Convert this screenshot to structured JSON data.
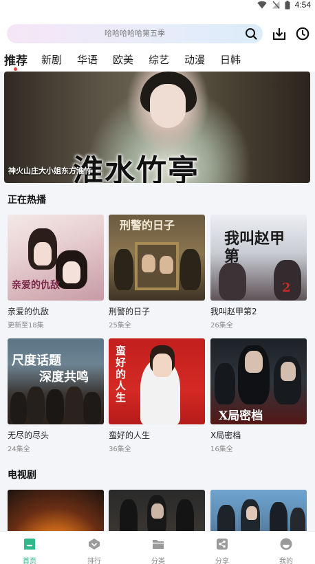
{
  "status_bar": {
    "time": "4:54"
  },
  "search": {
    "placeholder": "哈哈哈哈哈第五季"
  },
  "tabs": [
    {
      "label": "推荐",
      "active": true
    },
    {
      "label": "新剧"
    },
    {
      "label": "华语"
    },
    {
      "label": "欧美"
    },
    {
      "label": "综艺"
    },
    {
      "label": "动漫"
    },
    {
      "label": "日韩"
    }
  ],
  "banner": {
    "caption": "神火山庄大小姐东方淮竹",
    "artwork_text": "淮水竹亭"
  },
  "sections": [
    {
      "title": "正在热播",
      "items": [
        {
          "title": "亲爱的仇敌",
          "subtitle": "更新至18集",
          "poster_text": "亲爱的仇敌"
        },
        {
          "title": "刑警的日子",
          "subtitle": "25集全",
          "poster_text": "刑警的日子"
        },
        {
          "title": "我叫赵甲第2",
          "subtitle": "26集全",
          "poster_text": "我叫赵甲第"
        },
        {
          "title": "无尽的尽头",
          "subtitle": "24集全",
          "poster_text_line1": "尺度话题",
          "poster_text_line2": "深度共鸣"
        },
        {
          "title": "蛮好的人生",
          "subtitle": "36集全",
          "poster_text": "蛮好的人生"
        },
        {
          "title": "X局密档",
          "subtitle": "16集全",
          "poster_text": "X局密档"
        }
      ]
    },
    {
      "title": "电视剧"
    }
  ],
  "bottom_nav": [
    {
      "label": "首页",
      "icon": "home-icon",
      "active": true
    },
    {
      "label": "排行",
      "icon": "ranking-icon"
    },
    {
      "label": "分类",
      "icon": "folder-icon"
    },
    {
      "label": "分享",
      "icon": "share-icon"
    },
    {
      "label": "我的",
      "icon": "profile-icon"
    }
  ],
  "colors": {
    "accent": "#30b88a",
    "tab_indicator": "#e8423f",
    "background": "#f4f5f9"
  }
}
